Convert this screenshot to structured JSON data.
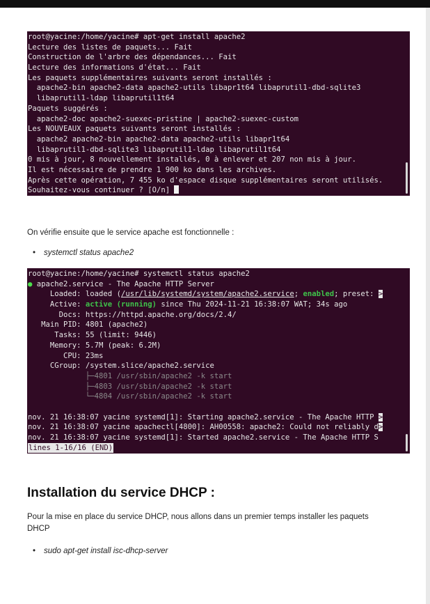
{
  "terminal1": {
    "prompt": "root@yacine:/home/yacine# apt-get install apache2",
    "lines": [
      "Lecture des listes de paquets... Fait",
      "Construction de l'arbre des dépendances... Fait",
      "Lecture des informations d'état... Fait",
      "Les paquets supplémentaires suivants seront installés :",
      "  apache2-bin apache2-data apache2-utils libapr1t64 libaprutil1-dbd-sqlite3",
      "  libaprutil1-ldap libaprutil1t64",
      "Paquets suggérés :",
      "  apache2-doc apache2-suexec-pristine | apache2-suexec-custom",
      "Les NOUVEAUX paquets suivants seront installés :",
      "  apache2 apache2-bin apache2-data apache2-utils libapr1t64",
      "  libaprutil1-dbd-sqlite3 libaprutil1-ldap libaprutil1t64",
      "0 mis à jour, 8 nouvellement installés, 0 à enlever et 207 non mis à jour.",
      "Il est nécessaire de prendre 1 900 ko dans les archives.",
      "Après cette opération, 7 455 ko d'espace disque supplémentaires seront utilisés."
    ],
    "question": "Souhaitez-vous continuer ? [O/n] "
  },
  "para1": "On vérifie ensuite que le service apache est fonctionnelle :",
  "bullet1": "systemctl status apache2",
  "terminal2": {
    "prompt": "root@yacine:/home/yacine# systemctl status apache2",
    "dot": "●",
    "service_line": " apache2.service - The Apache HTTP Server",
    "loaded_label": "     Loaded: ",
    "loaded_a": "loaded (",
    "loaded_path": "/usr/lib/systemd/system/apache2.service",
    "loaded_b": "; ",
    "enabled": "enabled",
    "loaded_c": "; preset: ",
    "more": ">",
    "active_label": "     Active: ",
    "active_state": "active (running)",
    "active_rest": " since Thu 2024-11-21 16:38:07 WAT; 34s ago",
    "docs_label": "       Docs: ",
    "docs_url": "https://httpd.apache.org/docs/2.4/",
    "mainpid": "   Main PID: 4801 (apache2)",
    "tasks": "      Tasks: 55 (limit: 9446)",
    "memory": "     Memory: 5.7M (peak: 6.2M)",
    "cpu": "        CPU: 23ms",
    "cgroup": "     CGroup: /system.slice/apache2.service",
    "procs": [
      "             ├─4801 /usr/sbin/apache2 -k start",
      "             ├─4803 /usr/sbin/apache2 -k start",
      "             └─4804 /usr/sbin/apache2 -k start"
    ],
    "logs": [
      "nov. 21 16:38:07 yacine systemd[1]: Starting apache2.service - The Apache HTTP ",
      "nov. 21 16:38:07 yacine apachectl[4800]: AH00558: apache2: Could not reliably d",
      "nov. 21 16:38:07 yacine systemd[1]: Started apache2.service - The Apache HTTP S"
    ],
    "end": "lines 1-16/16 (END)"
  },
  "heading": "Installation du service DHCP :",
  "para2_line1": "Pour la mise en place du service DHCP, nous allons dans un premier temps installer les paquets",
  "para2_line2": "DHCP",
  "bullet2": "sudo apt-get install isc-dhcp-server"
}
